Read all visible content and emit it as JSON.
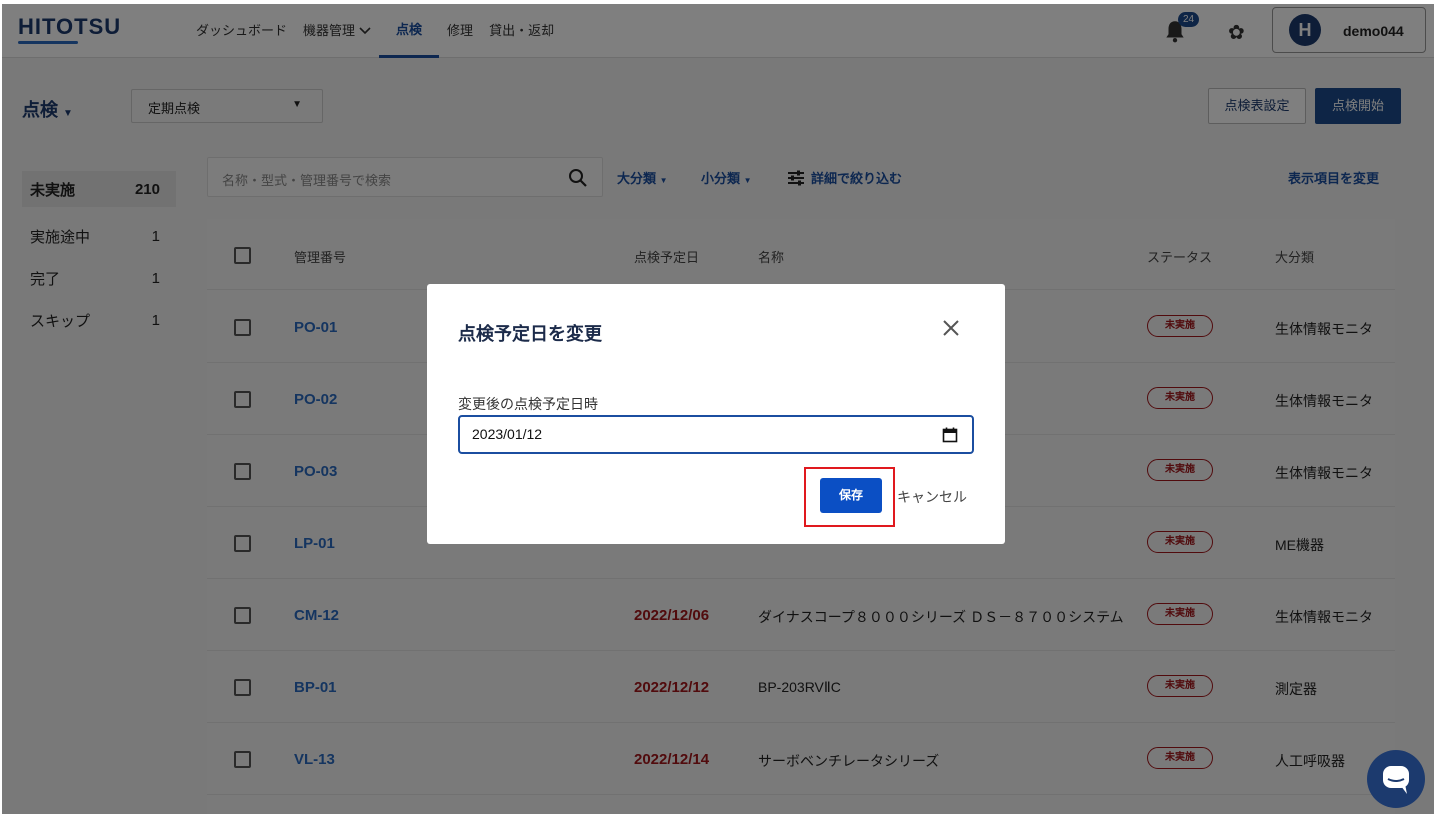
{
  "app": {
    "logo": "HITOTSU",
    "notification_count": "24",
    "user_initial": "H",
    "user_name": "demo044"
  },
  "nav": {
    "items": [
      {
        "label": "ダッシュボード"
      },
      {
        "label": "機器管理"
      },
      {
        "label": "点検",
        "active": true
      },
      {
        "label": "修理"
      },
      {
        "label": "貸出・返却"
      }
    ]
  },
  "toolbar": {
    "title": "点検",
    "type_select": "定期点検",
    "settings_button": "点検表設定",
    "start_button": "点検開始"
  },
  "status_filters": [
    {
      "label": "未実施",
      "count": "210",
      "active": true
    },
    {
      "label": "実施途中",
      "count": "1"
    },
    {
      "label": "完了",
      "count": "1"
    },
    {
      "label": "スキップ",
      "count": "1"
    }
  ],
  "search": {
    "placeholder": "名称・型式・管理番号で検索",
    "filter_large": "大分類",
    "filter_small": "小分類",
    "filter_detail": "詳細で絞り込む",
    "change_columns": "表示項目を変更"
  },
  "table": {
    "headers": {
      "id": "管理番号",
      "date": "点検予定日",
      "name": "名称",
      "status": "ステータス",
      "category": "大分類"
    },
    "rows": [
      {
        "id": "PO-01",
        "date": "",
        "name": "",
        "status": "未実施",
        "category": "生体情報モニタ"
      },
      {
        "id": "PO-02",
        "date": "",
        "name": "",
        "status": "未実施",
        "category": "生体情報モニタ"
      },
      {
        "id": "PO-03",
        "date": "",
        "name": "",
        "status": "未実施",
        "category": "生体情報モニタ"
      },
      {
        "id": "LP-01",
        "date": "",
        "name": "",
        "status": "未実施",
        "category": "ME機器"
      },
      {
        "id": "CM-12",
        "date": "2022/12/06",
        "name": "ダイナスコープ８０００シリーズ ＤＳ－８７００システム",
        "status": "未実施",
        "category": "生体情報モニタ"
      },
      {
        "id": "BP-01",
        "date": "2022/12/12",
        "name": "BP-203RVⅡC",
        "status": "未実施",
        "category": "測定器"
      },
      {
        "id": "VL-13",
        "date": "2022/12/14",
        "name": "サーボベンチレータシリーズ",
        "status": "未実施",
        "category": "人工呼吸器"
      }
    ]
  },
  "modal": {
    "title": "点検予定日を変更",
    "field_label": "変更後の点検予定日時",
    "date_value": "2023/01/12",
    "save": "保存",
    "cancel": "キャンセル"
  },
  "colors": {
    "brand": "#1c3a6e",
    "accent": "#1b4ea0",
    "overdue": "#a3161b",
    "highlight": "#e0191e"
  }
}
